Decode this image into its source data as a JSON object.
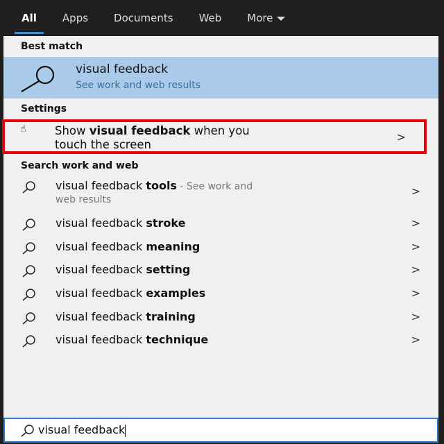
{
  "tabs": [
    {
      "label": "All",
      "active": true
    },
    {
      "label": "Apps"
    },
    {
      "label": "Documents"
    },
    {
      "label": "Web"
    },
    {
      "label": "More"
    }
  ],
  "best_match": {
    "header": "Best match",
    "title": "visual feedback",
    "subtitle": "See work and web results",
    "icon": "search-icon"
  },
  "settings": {
    "header": "Settings",
    "pre": "Show ",
    "bold": "visual feedback",
    "post": " when you",
    "line2": "touch the screen",
    "icon": "touch-hand-icon",
    "chevron": ">"
  },
  "web": {
    "header": "Search work and web",
    "items": [
      {
        "prefix": "visual feedback ",
        "bold": "tools",
        "suffix": " - See work and",
        "line2": "web results"
      },
      {
        "prefix": "visual feedback ",
        "bold": "stroke"
      },
      {
        "prefix": "visual feedback ",
        "bold": "meaning"
      },
      {
        "prefix": "visual feedback ",
        "bold": "setting"
      },
      {
        "prefix": "visual feedback ",
        "bold": "examples"
      },
      {
        "prefix": "visual feedback ",
        "bold": "training"
      },
      {
        "prefix": "visual feedback ",
        "bold": "technique"
      }
    ]
  },
  "search": {
    "value": "visual feedback"
  },
  "colors": {
    "highlight": "#a9cbe9",
    "annotation": "#e8000b",
    "accent": "#3a8fd8"
  }
}
